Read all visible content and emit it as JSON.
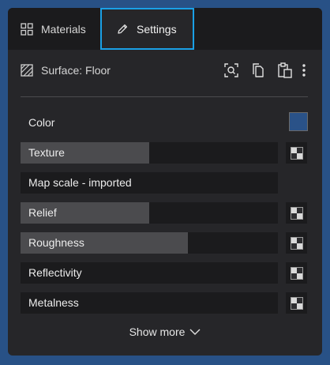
{
  "tabs": [
    {
      "label": "Materials",
      "icon": "grid-icon"
    },
    {
      "label": "Settings",
      "icon": "pencil-icon",
      "active": true
    }
  ],
  "surface": {
    "label": "Surface: Floor",
    "icon": "hatch-icon",
    "actions": [
      "scan-search-icon",
      "copy-icon",
      "paste-icon",
      "more-vertical-icon"
    ]
  },
  "color": {
    "label": "Color",
    "value": "#2a5288"
  },
  "properties": [
    {
      "label": "Texture",
      "level": 0.5,
      "texture_button": true
    },
    {
      "label": "Map scale - imported",
      "level": 0,
      "texture_button": false
    },
    {
      "label": "Relief",
      "level": 0.5,
      "texture_button": true
    },
    {
      "label": "Roughness",
      "level": 0.65,
      "texture_button": true
    },
    {
      "label": "Reflectivity",
      "level": 0,
      "texture_button": true
    },
    {
      "label": "Metalness",
      "level": 0,
      "texture_button": true
    }
  ],
  "show_more": {
    "label": "Show more",
    "icon": "chevron-down-icon"
  },
  "colors": {
    "accent": "#1aa0e6",
    "background": "#285186",
    "panel": "#262629"
  }
}
